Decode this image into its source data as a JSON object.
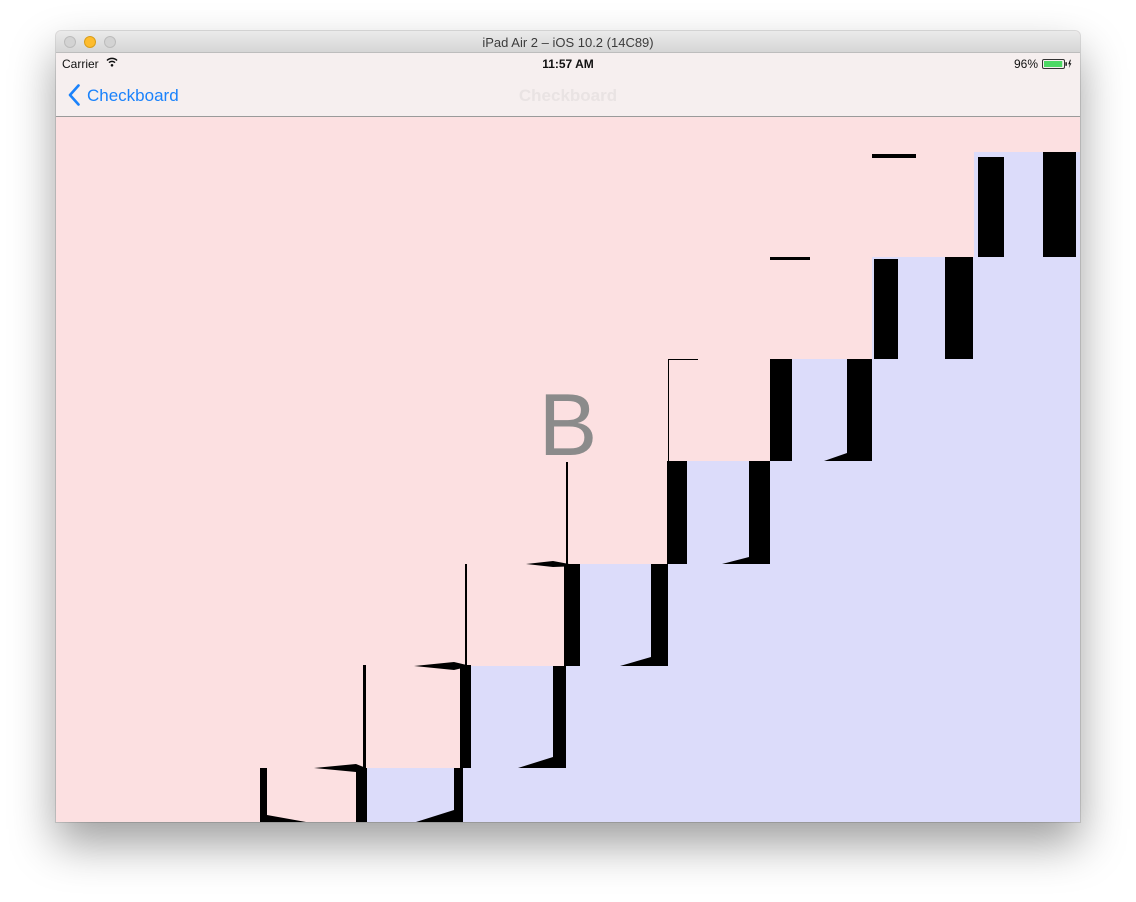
{
  "window": {
    "title": "iPad Air 2 – iOS 10.2 (14C89)"
  },
  "status_bar": {
    "carrier": "Carrier",
    "time": "11:57 AM",
    "battery": "96%",
    "battery_level": 0.96
  },
  "nav_bar": {
    "back_label": "Checkboard",
    "title": "Checkboard"
  },
  "content": {
    "letter": "B",
    "background_color": "#fce0e1",
    "tile_color": "#dcdcfa",
    "edge_color": "#000000"
  },
  "colors": {
    "accent": "#1a82fb",
    "battery_fill": "#4cd964"
  },
  "icons": [
    "close-icon",
    "minimize-icon",
    "zoom-icon",
    "wifi-icon",
    "battery-icon",
    "chevron-left-icon"
  ]
}
